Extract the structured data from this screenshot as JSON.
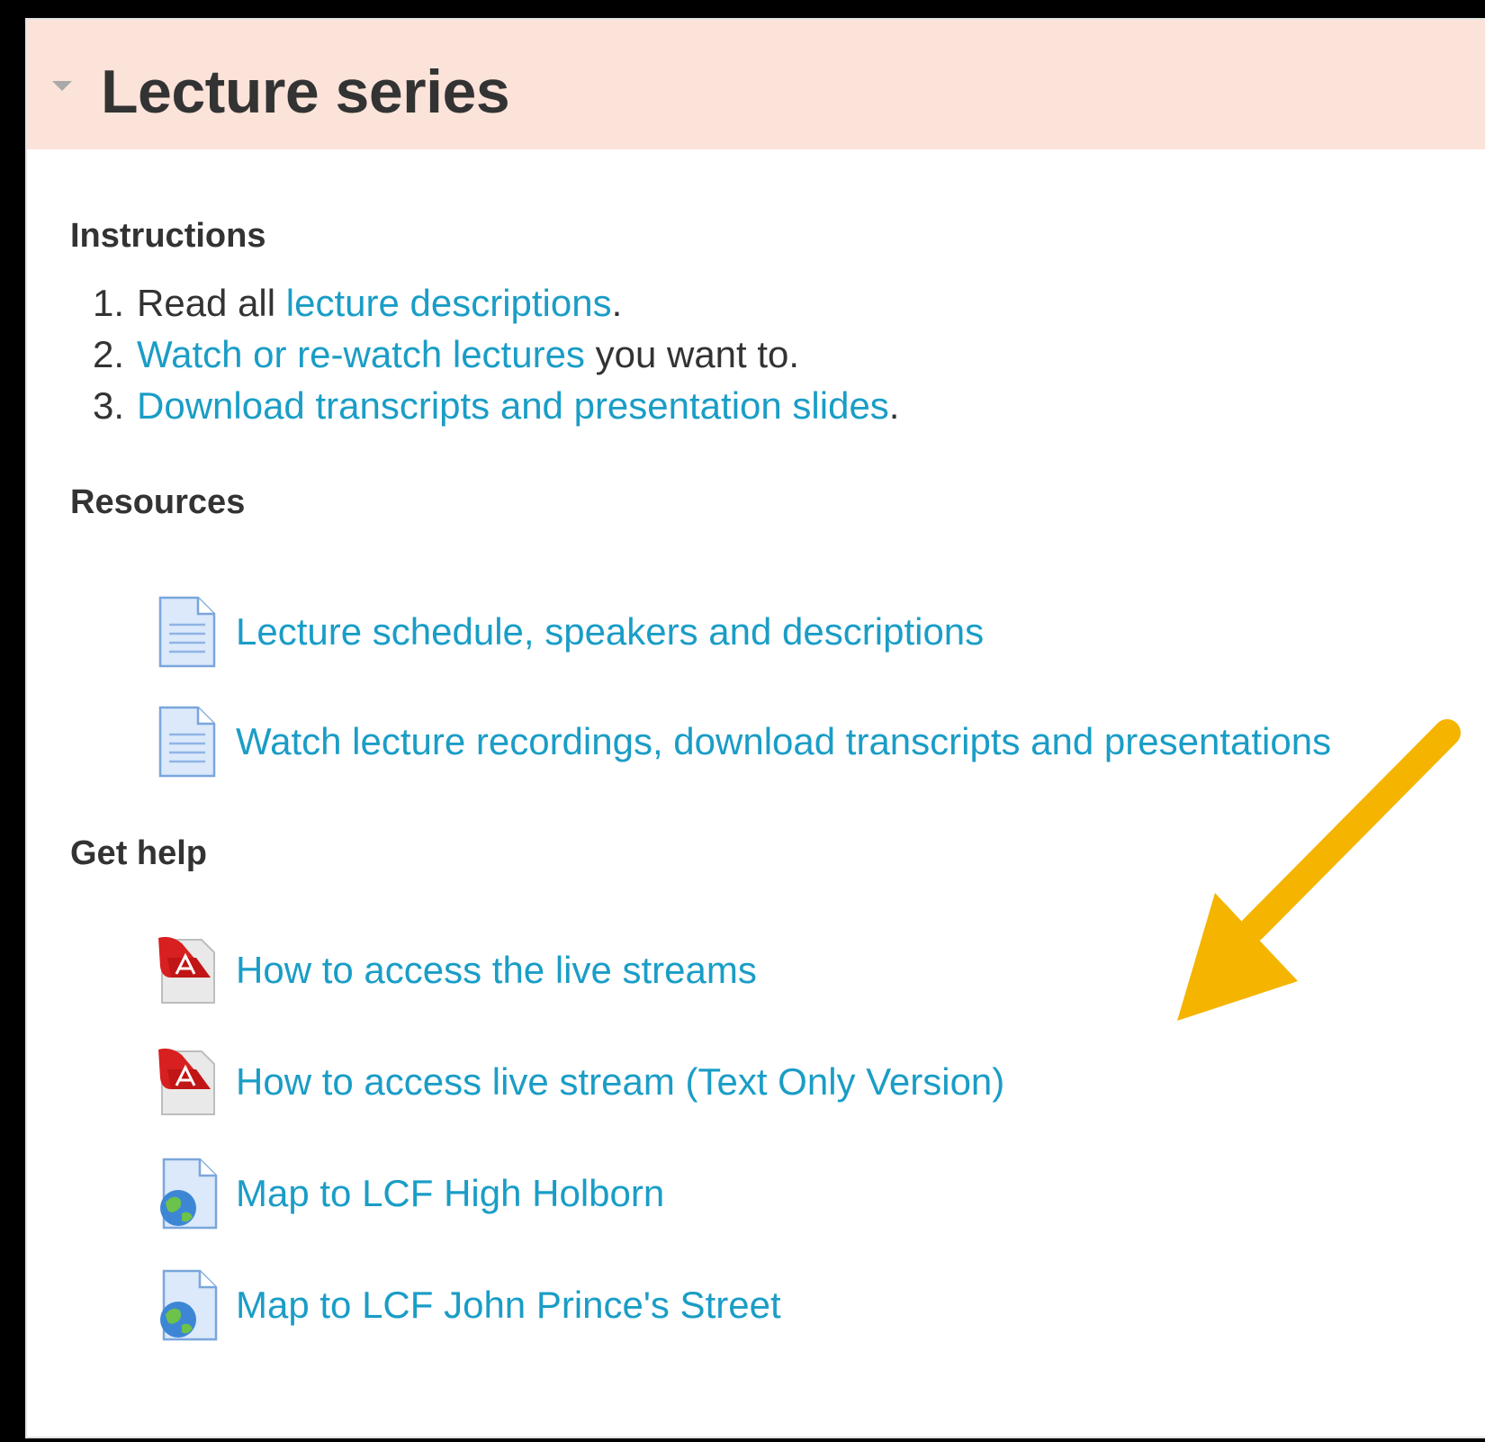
{
  "section": {
    "title": "Lecture series"
  },
  "instructions": {
    "heading": "Instructions",
    "steps": [
      {
        "num": "1.",
        "pre": "Read all ",
        "link": "lecture descriptions",
        "post": "."
      },
      {
        "num": "2.",
        "pre": "",
        "link": "Watch or re-watch lectures",
        "post": " you want to."
      },
      {
        "num": "3.",
        "pre": "",
        "link": "Download transcripts and presentation slides",
        "post": "."
      }
    ]
  },
  "resources": {
    "heading": "Resources",
    "items": [
      {
        "label": "Lecture schedule, speakers and descriptions",
        "icon": "document-icon"
      },
      {
        "label": "Watch lecture recordings, download transcripts and presentations",
        "icon": "document-icon"
      }
    ]
  },
  "help": {
    "heading": "Get help",
    "items": [
      {
        "label": "How to access the live streams",
        "icon": "pdf-icon"
      },
      {
        "label": "How to access live stream (Text Only Version)",
        "icon": "pdf-icon"
      },
      {
        "label": "Map to LCF High Holborn",
        "icon": "globe-page-icon"
      },
      {
        "label": "Map to LCF John Prince's Street",
        "icon": "globe-page-icon"
      }
    ]
  },
  "colors": {
    "header_bg": "#fce3da",
    "link": "#1a9dc6",
    "text": "#333333",
    "arrow": "#f5b400"
  }
}
